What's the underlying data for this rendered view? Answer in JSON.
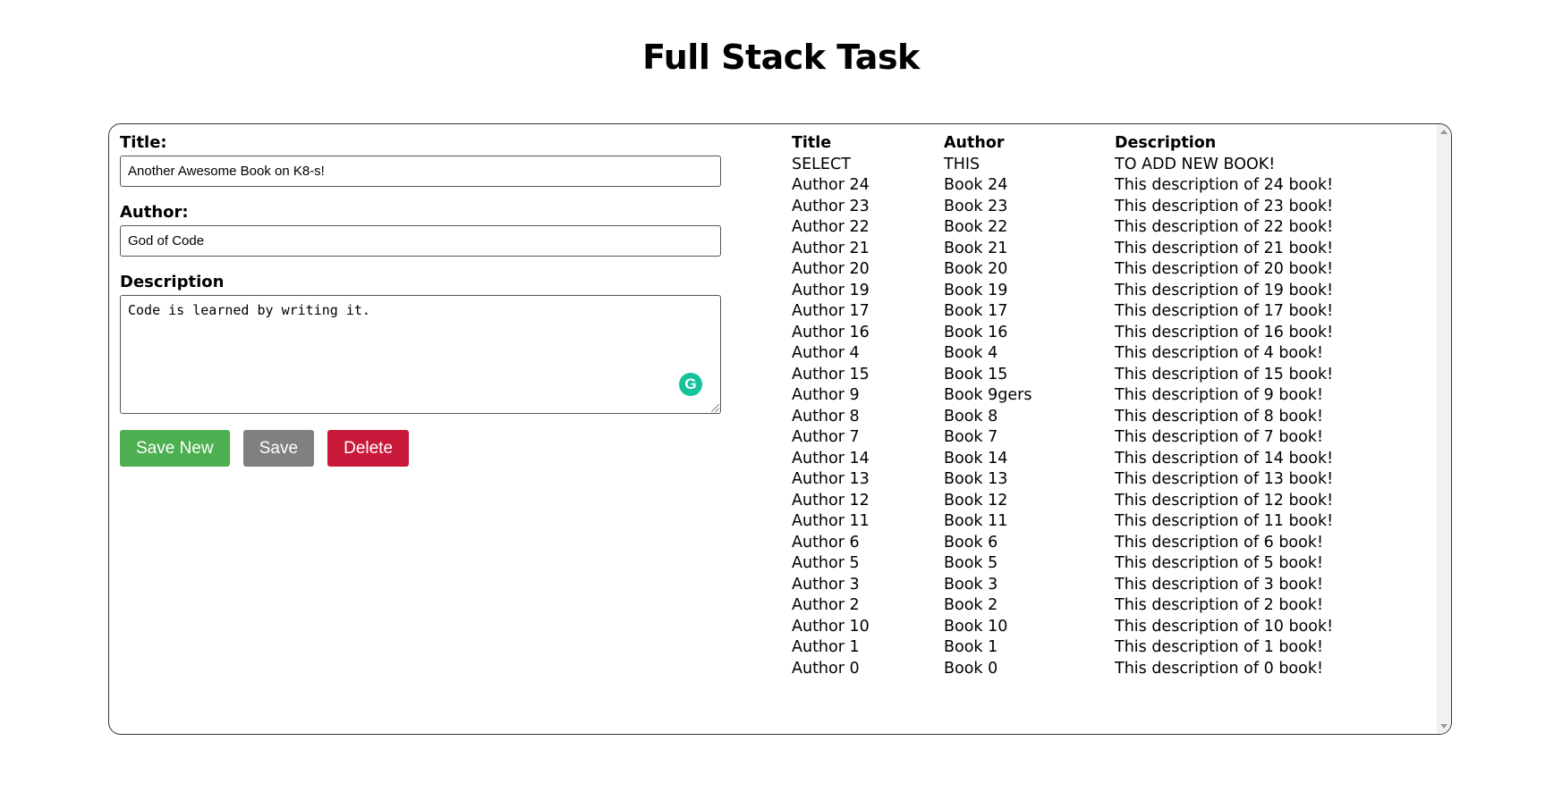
{
  "page": {
    "title": "Full Stack Task"
  },
  "form": {
    "title_label": "Title:",
    "title_value": "Another Awesome Book on K8-s!",
    "author_label": "Author:",
    "author_value": "God of Code",
    "description_label": "Description",
    "description_value": "Code is learned by writing it.",
    "grammarly_glyph": "G"
  },
  "buttons": {
    "save_new": "Save New",
    "save": "Save",
    "delete": "Delete"
  },
  "colors": {
    "save_new": "#4caf50",
    "save": "#808080",
    "delete": "#c8193a",
    "grammarly": "#15c39a"
  },
  "table": {
    "headers": [
      "Title",
      "Author",
      "Description"
    ],
    "rows": [
      [
        "SELECT",
        "THIS",
        "TO ADD NEW BOOK!"
      ],
      [
        "Author 24",
        "Book 24",
        "This description of 24 book!"
      ],
      [
        "Author 23",
        "Book 23",
        "This description of 23 book!"
      ],
      [
        "Author 22",
        "Book 22",
        "This description of 22 book!"
      ],
      [
        "Author 21",
        "Book 21",
        "This description of 21 book!"
      ],
      [
        "Author 20",
        "Book 20",
        "This description of 20 book!"
      ],
      [
        "Author 19",
        "Book 19",
        "This description of 19 book!"
      ],
      [
        "Author 17",
        "Book 17",
        "This description of 17 book!"
      ],
      [
        "Author 16",
        "Book 16",
        "This description of 16 book!"
      ],
      [
        "Author 4",
        "Book 4",
        "This description of 4 book!"
      ],
      [
        "Author 15",
        "Book 15",
        "This description of 15 book!"
      ],
      [
        "Author 9",
        "Book 9gers",
        "This description of 9 book!"
      ],
      [
        "Author 8",
        "Book 8",
        "This description of 8 book!"
      ],
      [
        "Author 7",
        "Book 7",
        "This description of 7 book!"
      ],
      [
        "Author 14",
        "Book 14",
        "This description of 14 book!"
      ],
      [
        "Author 13",
        "Book 13",
        "This description of 13 book!"
      ],
      [
        "Author 12",
        "Book 12",
        "This description of 12 book!"
      ],
      [
        "Author 11",
        "Book 11",
        "This description of 11 book!"
      ],
      [
        "Author 6",
        "Book 6",
        "This description of 6 book!"
      ],
      [
        "Author 5",
        "Book 5",
        "This description of 5 book!"
      ],
      [
        "Author 3",
        "Book 3",
        "This description of 3 book!"
      ],
      [
        "Author 2",
        "Book 2",
        "This description of 2 book!"
      ],
      [
        "Author 10",
        "Book 10",
        "This description of 10 book!"
      ],
      [
        "Author 1",
        "Book 1",
        "This description of 1 book!"
      ],
      [
        "Author 0",
        "Book 0",
        "This description of 0 book!"
      ]
    ]
  }
}
